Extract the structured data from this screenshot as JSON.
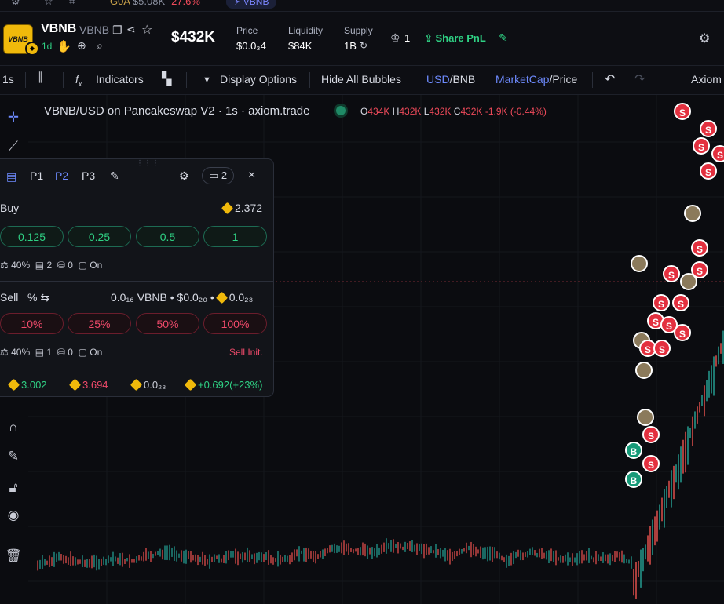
{
  "top_strip": {
    "token": "G0A",
    "mcap": "$5.08K",
    "change": "-27.6%",
    "active_tab": "VBNB"
  },
  "header": {
    "token_name": "VBNB",
    "ticker": "VBNB",
    "logo_text": "VBNB",
    "age": "1d",
    "market_cap": "$432K",
    "stats": [
      {
        "label": "Price",
        "value": "$0.0₃4"
      },
      {
        "label": "Liquidity",
        "value": "$84K"
      },
      {
        "label": "Supply",
        "value": "1B"
      }
    ],
    "holders_count": "1",
    "share_label": "Share PnL"
  },
  "toolbar": {
    "interval": "1s",
    "indicators": "Indicators",
    "display_options": "Display Options",
    "hide_bubbles": "Hide All Bubbles",
    "usd": "USD",
    "bnb": "/BNB",
    "marketcap": "MarketCap",
    "price": "/Price",
    "brand": "Axiom"
  },
  "chart": {
    "legend": "VBNB/USD on Pancakeswap V2 · 1s · axiom.trade",
    "ohlc": {
      "o": "434K",
      "h": "432K",
      "l": "432K",
      "c": "432K",
      "change": "-1.9K (-0.44%)"
    },
    "colors": {
      "up": "#26a69a",
      "down": "#ef5350",
      "bg": "#0b0c10"
    }
  },
  "panel": {
    "tabs": [
      "P1",
      "P2",
      "P3"
    ],
    "active_tab": "P2",
    "wallet_count": "2",
    "buy": {
      "label": "Buy",
      "balance": "2.372",
      "amounts": [
        "0.125",
        "0.25",
        "0.5",
        "1"
      ],
      "settings": {
        "slippage": "40%",
        "priority": "2",
        "bribe": "0",
        "mev": "On"
      }
    },
    "sell": {
      "label": "Sell",
      "unit": "%",
      "summary": "0.0₁₆ VBNB • $0.0₂₀ •",
      "summary_bnb": "0.0₂₃",
      "amounts": [
        "10%",
        "25%",
        "50%",
        "100%"
      ],
      "settings": {
        "slippage": "40%",
        "priority": "1",
        "bribe": "0",
        "mev": "On"
      },
      "sell_init": "Sell Init."
    },
    "pnl": {
      "bought": "3.002",
      "sold": "3.694",
      "holding": "0.0₂₃",
      "pnl": "+0.692(+23%)"
    }
  }
}
